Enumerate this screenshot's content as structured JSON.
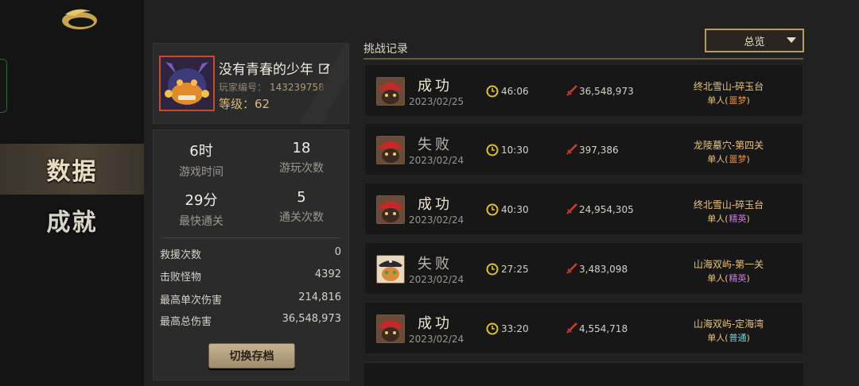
{
  "nav": {
    "data_label": "数据",
    "achievement_label": "成就"
  },
  "profile": {
    "name": "没有青春的少年",
    "id_label": "玩家编号：",
    "id_value": "143239758",
    "level_text": "等级：62"
  },
  "stats": {
    "play_time": {
      "value": "6时",
      "label": "游戏时间"
    },
    "play_count": {
      "value": "18",
      "label": "游玩次数"
    },
    "fastest_clear": {
      "value": "29分",
      "label": "最快通关"
    },
    "clear_count": {
      "value": "5",
      "label": "通关次数"
    },
    "rows": [
      {
        "label": "救援次数",
        "value": "0"
      },
      {
        "label": "击败怪物",
        "value": "4392"
      },
      {
        "label": "最高单次伤害",
        "value": "214,816"
      },
      {
        "label": "最高总伤害",
        "value": "36,548,973"
      }
    ],
    "switch_button": "切换存档"
  },
  "records": {
    "title": "挑战记录",
    "filter": "总览",
    "items": [
      {
        "result": "成功",
        "date": "2023/02/25",
        "time": "46:06",
        "damage": "36,548,973",
        "stage": "终北雪山-碎玉台",
        "mode": "单人(",
        "difficulty": "噩梦",
        "close": ")"
      },
      {
        "result": "失败",
        "date": "2023/02/24",
        "time": "10:30",
        "damage": "397,386",
        "stage": "龙陵墓穴-第四关",
        "mode": "单人(",
        "difficulty": "噩梦",
        "close": ")"
      },
      {
        "result": "成功",
        "date": "2023/02/24",
        "time": "40:30",
        "damage": "24,954,305",
        "stage": "终北雪山-碎玉台",
        "mode": "单人(",
        "difficulty": "精英",
        "close": ")"
      },
      {
        "result": "失败",
        "date": "2023/02/24",
        "time": "27:25",
        "damage": "3,483,098",
        "stage": "山海双屿-第一关",
        "mode": "单人(",
        "difficulty": "精英",
        "close": ")"
      },
      {
        "result": "成功",
        "date": "2023/02/24",
        "time": "33:20",
        "damage": "4,554,718",
        "stage": "山海双屿-定海湾",
        "mode": "单人(",
        "difficulty": "普通",
        "close": ")"
      }
    ]
  }
}
